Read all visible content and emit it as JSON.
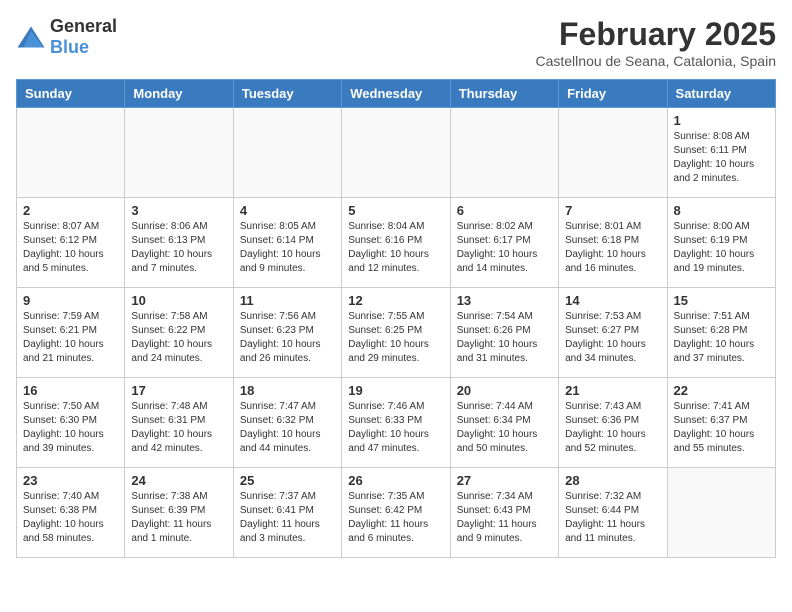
{
  "logo": {
    "general": "General",
    "blue": "Blue"
  },
  "title": {
    "month_year": "February 2025",
    "location": "Castellnou de Seana, Catalonia, Spain"
  },
  "headers": [
    "Sunday",
    "Monday",
    "Tuesday",
    "Wednesday",
    "Thursday",
    "Friday",
    "Saturday"
  ],
  "weeks": [
    [
      {
        "day": "",
        "info": ""
      },
      {
        "day": "",
        "info": ""
      },
      {
        "day": "",
        "info": ""
      },
      {
        "day": "",
        "info": ""
      },
      {
        "day": "",
        "info": ""
      },
      {
        "day": "",
        "info": ""
      },
      {
        "day": "1",
        "info": "Sunrise: 8:08 AM\nSunset: 6:11 PM\nDaylight: 10 hours and 2 minutes."
      }
    ],
    [
      {
        "day": "2",
        "info": "Sunrise: 8:07 AM\nSunset: 6:12 PM\nDaylight: 10 hours and 5 minutes."
      },
      {
        "day": "3",
        "info": "Sunrise: 8:06 AM\nSunset: 6:13 PM\nDaylight: 10 hours and 7 minutes."
      },
      {
        "day": "4",
        "info": "Sunrise: 8:05 AM\nSunset: 6:14 PM\nDaylight: 10 hours and 9 minutes."
      },
      {
        "day": "5",
        "info": "Sunrise: 8:04 AM\nSunset: 6:16 PM\nDaylight: 10 hours and 12 minutes."
      },
      {
        "day": "6",
        "info": "Sunrise: 8:02 AM\nSunset: 6:17 PM\nDaylight: 10 hours and 14 minutes."
      },
      {
        "day": "7",
        "info": "Sunrise: 8:01 AM\nSunset: 6:18 PM\nDaylight: 10 hours and 16 minutes."
      },
      {
        "day": "8",
        "info": "Sunrise: 8:00 AM\nSunset: 6:19 PM\nDaylight: 10 hours and 19 minutes."
      }
    ],
    [
      {
        "day": "9",
        "info": "Sunrise: 7:59 AM\nSunset: 6:21 PM\nDaylight: 10 hours and 21 minutes."
      },
      {
        "day": "10",
        "info": "Sunrise: 7:58 AM\nSunset: 6:22 PM\nDaylight: 10 hours and 24 minutes."
      },
      {
        "day": "11",
        "info": "Sunrise: 7:56 AM\nSunset: 6:23 PM\nDaylight: 10 hours and 26 minutes."
      },
      {
        "day": "12",
        "info": "Sunrise: 7:55 AM\nSunset: 6:25 PM\nDaylight: 10 hours and 29 minutes."
      },
      {
        "day": "13",
        "info": "Sunrise: 7:54 AM\nSunset: 6:26 PM\nDaylight: 10 hours and 31 minutes."
      },
      {
        "day": "14",
        "info": "Sunrise: 7:53 AM\nSunset: 6:27 PM\nDaylight: 10 hours and 34 minutes."
      },
      {
        "day": "15",
        "info": "Sunrise: 7:51 AM\nSunset: 6:28 PM\nDaylight: 10 hours and 37 minutes."
      }
    ],
    [
      {
        "day": "16",
        "info": "Sunrise: 7:50 AM\nSunset: 6:30 PM\nDaylight: 10 hours and 39 minutes."
      },
      {
        "day": "17",
        "info": "Sunrise: 7:48 AM\nSunset: 6:31 PM\nDaylight: 10 hours and 42 minutes."
      },
      {
        "day": "18",
        "info": "Sunrise: 7:47 AM\nSunset: 6:32 PM\nDaylight: 10 hours and 44 minutes."
      },
      {
        "day": "19",
        "info": "Sunrise: 7:46 AM\nSunset: 6:33 PM\nDaylight: 10 hours and 47 minutes."
      },
      {
        "day": "20",
        "info": "Sunrise: 7:44 AM\nSunset: 6:34 PM\nDaylight: 10 hours and 50 minutes."
      },
      {
        "day": "21",
        "info": "Sunrise: 7:43 AM\nSunset: 6:36 PM\nDaylight: 10 hours and 52 minutes."
      },
      {
        "day": "22",
        "info": "Sunrise: 7:41 AM\nSunset: 6:37 PM\nDaylight: 10 hours and 55 minutes."
      }
    ],
    [
      {
        "day": "23",
        "info": "Sunrise: 7:40 AM\nSunset: 6:38 PM\nDaylight: 10 hours and 58 minutes."
      },
      {
        "day": "24",
        "info": "Sunrise: 7:38 AM\nSunset: 6:39 PM\nDaylight: 11 hours and 1 minute."
      },
      {
        "day": "25",
        "info": "Sunrise: 7:37 AM\nSunset: 6:41 PM\nDaylight: 11 hours and 3 minutes."
      },
      {
        "day": "26",
        "info": "Sunrise: 7:35 AM\nSunset: 6:42 PM\nDaylight: 11 hours and 6 minutes."
      },
      {
        "day": "27",
        "info": "Sunrise: 7:34 AM\nSunset: 6:43 PM\nDaylight: 11 hours and 9 minutes."
      },
      {
        "day": "28",
        "info": "Sunrise: 7:32 AM\nSunset: 6:44 PM\nDaylight: 11 hours and 11 minutes."
      },
      {
        "day": "",
        "info": ""
      }
    ]
  ]
}
